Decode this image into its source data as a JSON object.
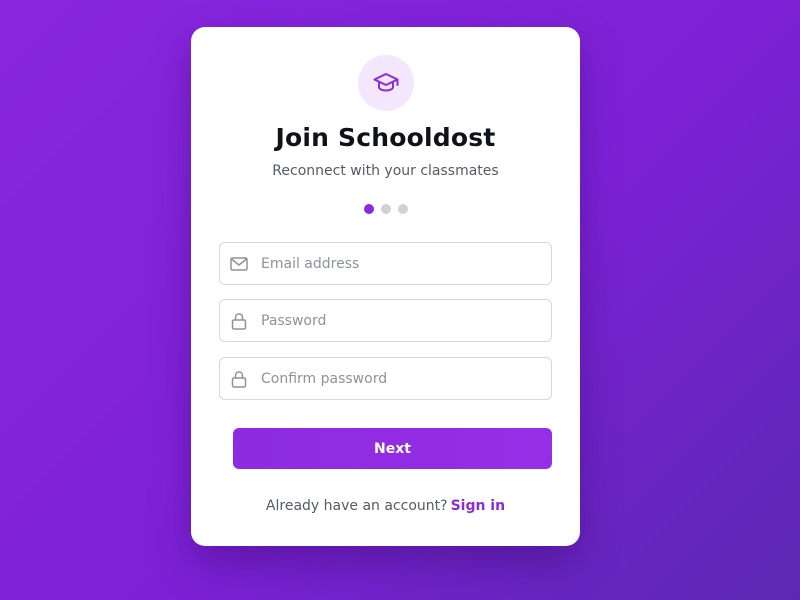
{
  "app": {
    "title": "Join Schooldost",
    "subtitle": "Reconnect with your classmates",
    "logo_icon": "graduation-cap-icon",
    "accent_color": "#8a2be2"
  },
  "steps": {
    "total": 3,
    "current": 1
  },
  "form": {
    "email": {
      "placeholder": "Email address",
      "value": "",
      "icon": "mail-icon"
    },
    "password": {
      "placeholder": "Password",
      "value": "",
      "icon": "lock-icon"
    },
    "confirm_password": {
      "placeholder": "Confirm password",
      "value": "",
      "icon": "lock-icon"
    },
    "submit_label": "Next"
  },
  "footer": {
    "prompt": "Already have an account?",
    "link_label": "Sign in"
  }
}
